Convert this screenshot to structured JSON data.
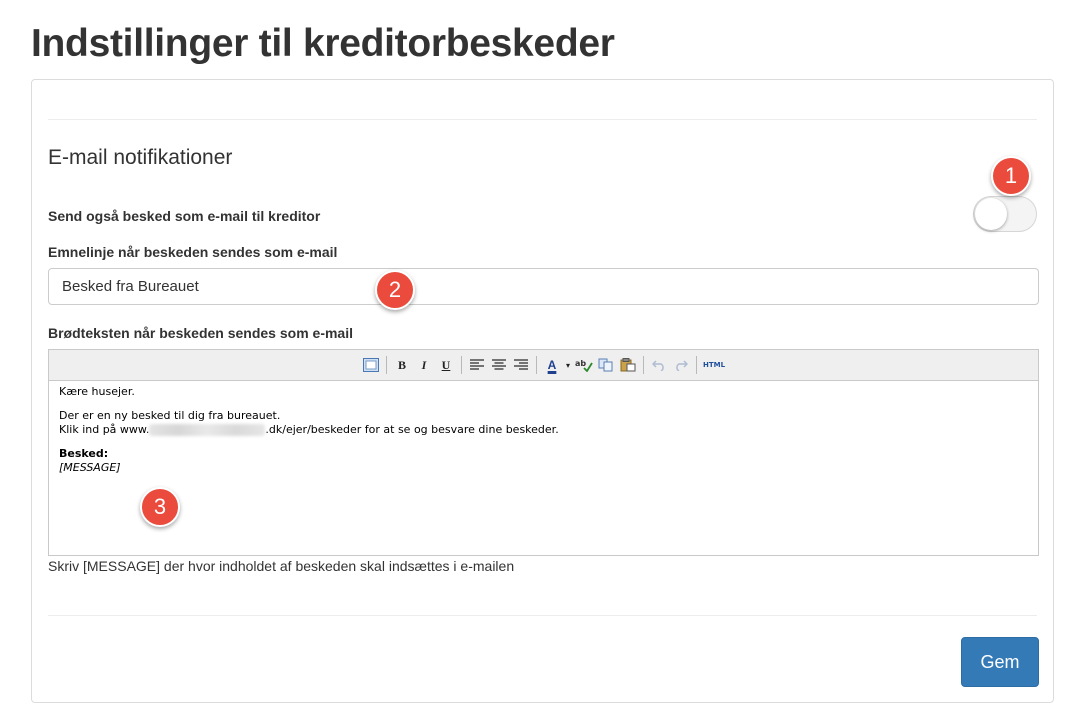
{
  "page": {
    "title": "Indstillinger til kreditorbeskeder"
  },
  "email_section": {
    "title": "E-mail notifikationer",
    "send_email_label": "Send også besked som e-mail til kreditor",
    "send_email_enabled": false,
    "subject_label": "Emnelinje når beskeden sendes som e-mail",
    "subject_value": "Besked fra Bureauet",
    "body_label": "Brødteksten når beskeden sendes som e-mail",
    "hint": "Skriv [MESSAGE] der hvor indholdet af beskeden skal indsættes i e-mailen"
  },
  "editor": {
    "toolbar": {
      "bold": "B",
      "italic": "I",
      "underline": "U",
      "font_color": "A",
      "html": "HTML"
    },
    "content": {
      "greeting": "Kære husejer.",
      "line1": "Der er en ny besked til dig fra bureauet.",
      "line2_prefix": "Klik ind på www.",
      "line2_suffix": ".dk/ejer/beskeder for at se og besvare dine beskeder.",
      "besked_label": "Besked:",
      "placeholder": "[MESSAGE]"
    }
  },
  "actions": {
    "save_label": "Gem"
  },
  "markers": [
    "1",
    "2",
    "3"
  ],
  "colors": {
    "primary": "#337ab7",
    "marker": "#ea4b3c"
  }
}
